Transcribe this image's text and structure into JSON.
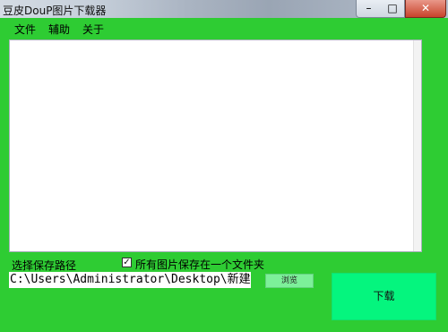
{
  "window": {
    "title": "豆皮DouP图片下载器",
    "minimize": "–",
    "maximize": "□",
    "close": "✕"
  },
  "menu": {
    "items": [
      "文件",
      "辅助",
      "关于"
    ]
  },
  "log_area": {
    "value": ""
  },
  "controls": {
    "path_label": "选择保存路径",
    "checkbox_label": "所有图片保存在一个文件夹",
    "checkbox_mark": "✓",
    "checkbox_checked": true,
    "path_value": "C:\\Users\\Administrator\\Desktop\\新建文件",
    "browse_label": "浏览",
    "download_label": "下载"
  },
  "colors": {
    "window_bg": "#2ecc33",
    "download_button": "#05f57e",
    "browse_button": "#7df09a"
  }
}
